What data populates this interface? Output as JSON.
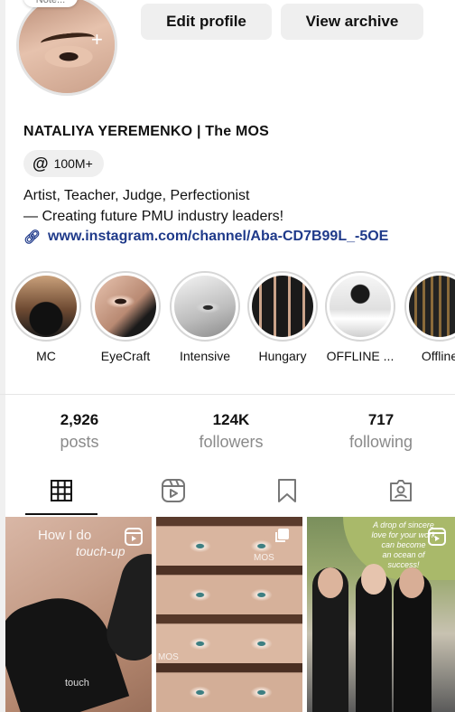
{
  "profile": {
    "note": "Note...",
    "name": "NATALIYA YEREMENKO | The MOS",
    "threads_count": "100M+",
    "bio_line1": "Artist, Teacher, Judge, Perfectionist",
    "bio_line2": "— Creating future PMU industry leaders!",
    "link": "www.instagram.com/channel/Aba-CD7B99L_-5OE"
  },
  "buttons": {
    "edit": "Edit profile",
    "archive": "View archive"
  },
  "highlights": [
    {
      "label": "MC"
    },
    {
      "label": "EyeCraft"
    },
    {
      "label": "Intensive"
    },
    {
      "label": "Hungary"
    },
    {
      "label": "OFFLINE ..."
    },
    {
      "label": "Offline"
    }
  ],
  "stats": {
    "posts_num": "2,926",
    "posts_label": "posts",
    "followers_num": "124K",
    "followers_label": "followers",
    "following_num": "717",
    "following_label": "following"
  },
  "tabs": [
    "grid-icon",
    "reels-icon",
    "saved-icon",
    "tagged-icon"
  ],
  "posts": {
    "p1_overlay_title": "How I do",
    "p1_overlay_sub": "touch-up",
    "p1_bottom": "touch",
    "p2_watermark1": "MOS",
    "p2_watermark2": "MOS",
    "p3_quote_l1": "A drop of sincere",
    "p3_quote_l2": "love for your work",
    "p3_quote_l3": "can become",
    "p3_quote_l4": "an ocean of",
    "p3_quote_l5": "success!"
  }
}
